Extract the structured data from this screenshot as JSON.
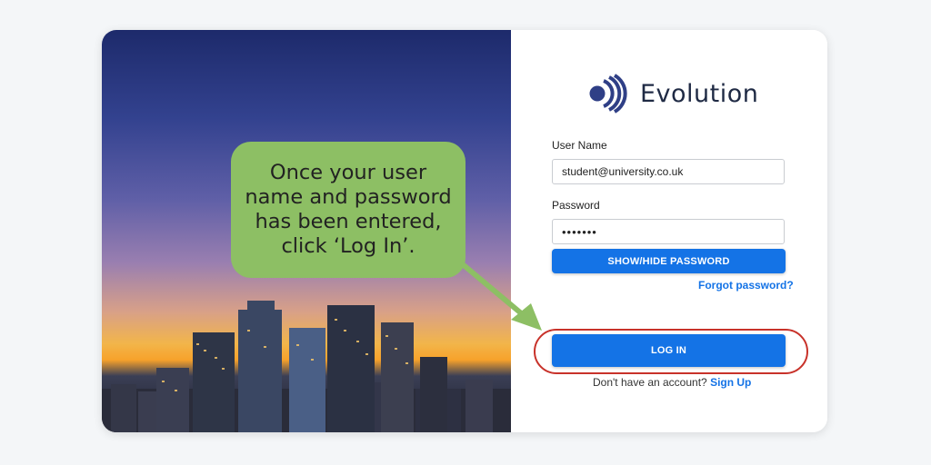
{
  "brand": {
    "name": "Evolution",
    "logo_color": "#2f3f86"
  },
  "login_form": {
    "username_label": "User Name",
    "username_value": "student@university.co.uk",
    "password_label": "Password",
    "password_value": "•••••••",
    "show_hide_label": "SHOW/HIDE PASSWORD",
    "forgot_password_label": "Forgot password?",
    "login_label": "LOG IN",
    "no_account_text": "Don't have an account?",
    "sign_up_label": "Sign Up"
  },
  "callout": {
    "text": "Once your user name and password has been entered, click ‘Log In’.",
    "color": "#8dbf64",
    "highlight_color": "#c8322a"
  },
  "colors": {
    "accent": "#1473e6"
  }
}
